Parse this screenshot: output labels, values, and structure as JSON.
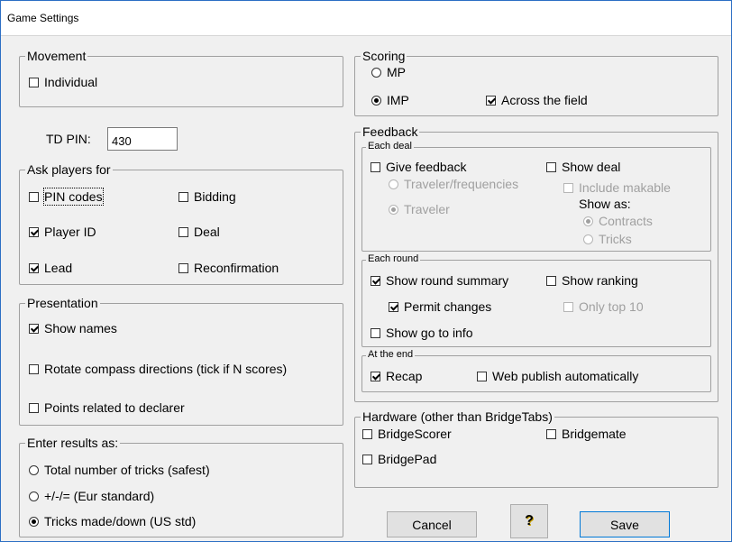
{
  "window": {
    "title": "Game Settings"
  },
  "movement": {
    "label": "Movement",
    "individual": {
      "label": "Individual",
      "checked": false
    }
  },
  "td_pin": {
    "label": "TD PIN:",
    "value": "430"
  },
  "ask_players": {
    "label": "Ask players for",
    "pin_codes": {
      "label": "PIN codes",
      "checked": false
    },
    "bidding": {
      "label": "Bidding",
      "checked": false
    },
    "player_id": {
      "label": "Player ID",
      "checked": true
    },
    "deal": {
      "label": "Deal",
      "checked": false
    },
    "lead": {
      "label": "Lead",
      "checked": true
    },
    "reconfirmation": {
      "label": "Reconfirmation",
      "checked": false
    }
  },
  "presentation": {
    "label": "Presentation",
    "show_names": {
      "label": "Show names",
      "checked": true
    },
    "rotate": {
      "label": "Rotate compass directions (tick if N scores)",
      "checked": false
    },
    "points_declarer": {
      "label": "Points related to declarer",
      "checked": false
    }
  },
  "enter_results": {
    "label": "Enter results as:",
    "total_tricks": {
      "label": "Total number of tricks (safest)",
      "selected": false
    },
    "plus_minus": {
      "label": "+/-/= (Eur standard)",
      "selected": false
    },
    "tricks_made": {
      "label": "Tricks made/down (US std)",
      "selected": true
    }
  },
  "scoring": {
    "label": "Scoring",
    "mp": {
      "label": "MP",
      "selected": false
    },
    "imp": {
      "label": "IMP",
      "selected": true
    },
    "across_field": {
      "label": "Across the field",
      "checked": true
    }
  },
  "feedback": {
    "label": "Feedback",
    "each_deal": {
      "label": "Each deal",
      "give_feedback": {
        "label": "Give feedback",
        "checked": false
      },
      "traveler_freq": {
        "label": "Traveler/frequencies",
        "selected": false
      },
      "traveler": {
        "label": "Traveler",
        "selected": true
      },
      "show_deal": {
        "label": "Show deal",
        "checked": false
      },
      "include_makable": {
        "label": "Include makable",
        "checked": false
      },
      "show_as": "Show as:",
      "contracts": {
        "label": "Contracts",
        "selected": true
      },
      "tricks": {
        "label": "Tricks",
        "selected": false
      }
    },
    "each_round": {
      "label": "Each round",
      "show_summary": {
        "label": "Show round summary",
        "checked": true
      },
      "permit_changes": {
        "label": "Permit changes",
        "checked": true
      },
      "show_goto": {
        "label": "Show go to info",
        "checked": false
      },
      "show_ranking": {
        "label": "Show ranking",
        "checked": false
      },
      "only_top10": {
        "label": "Only top 10",
        "checked": false
      }
    },
    "at_end": {
      "label": "At the end",
      "recap": {
        "label": "Recap",
        "checked": true
      },
      "web_publish": {
        "label": "Web publish automatically",
        "checked": false
      }
    }
  },
  "hardware": {
    "label": "Hardware (other than BridgeTabs)",
    "bridgescorer": {
      "label": "BridgeScorer",
      "checked": false
    },
    "bridgemate": {
      "label": "Bridgemate",
      "checked": false
    },
    "bridgepad": {
      "label": "BridgePad",
      "checked": false
    }
  },
  "buttons": {
    "cancel": "Cancel",
    "help_glyph": "?",
    "save": "Save"
  },
  "icons": {
    "help": "help-question-icon"
  }
}
